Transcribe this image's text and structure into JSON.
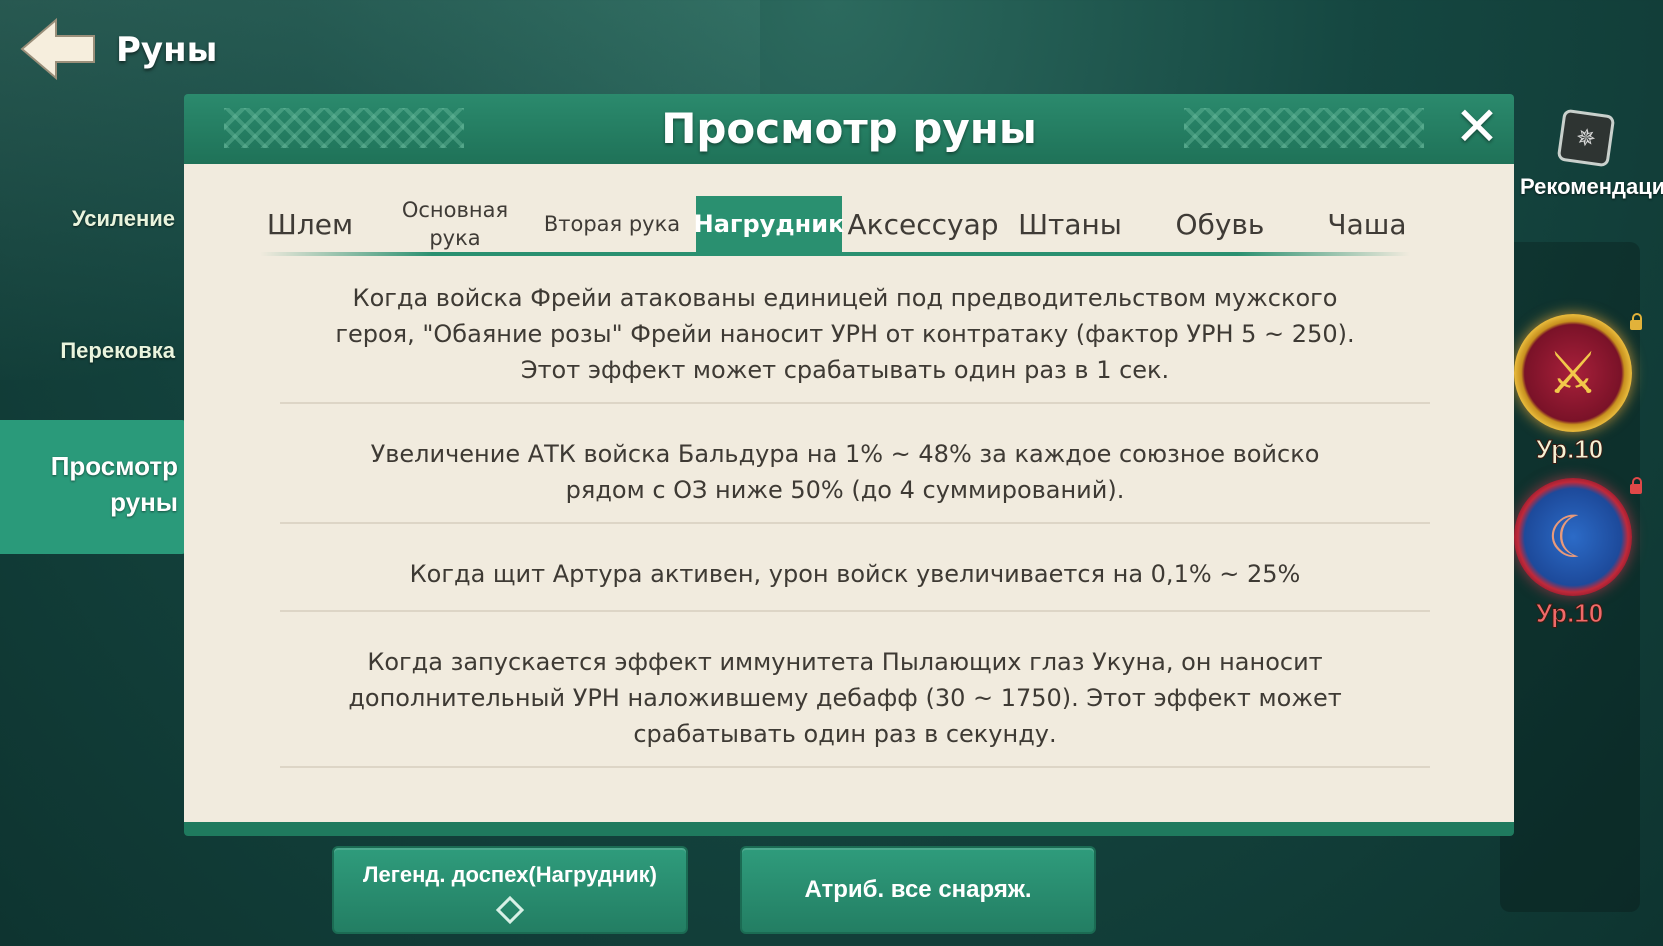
{
  "header": {
    "title": "Руны",
    "back_icon": "back-arrow-icon"
  },
  "nav": {
    "items": [
      {
        "label": "Усиление"
      },
      {
        "label": "Перековка"
      },
      {
        "label": "Просмотр\nруны",
        "active": true
      }
    ]
  },
  "right": {
    "recommend_label": "Рекомендации",
    "runes": [
      {
        "level": "Ур.10",
        "locked": true,
        "frame_color": "#e7b93b"
      },
      {
        "level": "Ур.10",
        "locked": true,
        "frame_color": "#c0293a"
      }
    ]
  },
  "modal": {
    "title": "Просмотр руны",
    "tabs": [
      {
        "label": "Шлем"
      },
      {
        "label": "Основная рука"
      },
      {
        "label": "Вторая рука"
      },
      {
        "label": "Нагрудник",
        "active": true
      },
      {
        "label": "Аксессуар"
      },
      {
        "label": "Штаны"
      },
      {
        "label": "Обувь"
      },
      {
        "label": "Чаша"
      }
    ],
    "effects": [
      "Когда войска Фрейи атакованы единицей под предводительством мужского героя, \"Обаяние розы\" Фрейи наносит УРН от контратаку (фактор УРН 5 ~ 250). Этот эффект может срабатывать один раз в 1 сек.",
      "Увеличение АТК войска Бальдура на 1% ~ 48% за каждое союзное войско рядом с ОЗ ниже 50% (до 4 суммирований).",
      "Когда щит Артура активен, урон войск увеличивается на 0,1% ~ 25%",
      "Когда запускается эффект иммунитета Пылающих глаз Укуна, он наносит дополнительный УРН наложившему дебафф (30 ~ 1750). Этот эффект может срабатывать один раз в секунду."
    ]
  },
  "buttons": {
    "legend_armor": "Легенд. доспех(Нагрудник)",
    "all_gear_attr": "Атриб. все снаряж."
  },
  "colors": {
    "accent": "#2a9070",
    "panel": "#f1ebde",
    "text": "#3e3a34"
  }
}
